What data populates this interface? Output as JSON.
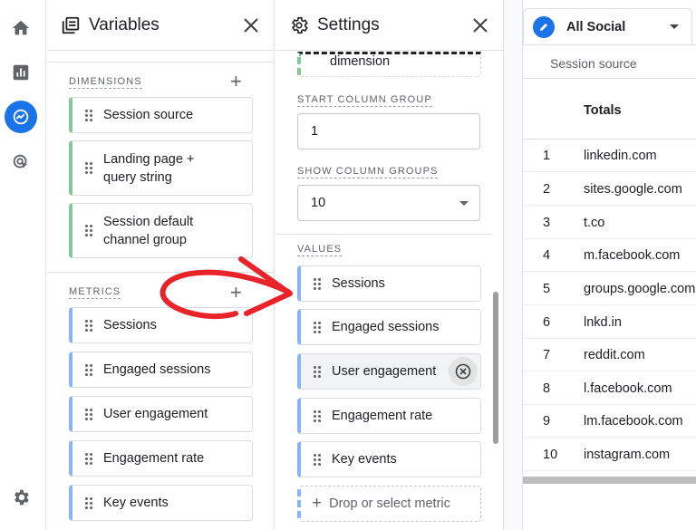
{
  "variables_panel": {
    "title": "Variables",
    "dimensions_label": "DIMENSIONS",
    "dimensions": [
      "Session source",
      "Landing page + query string",
      "Session default channel group"
    ],
    "metrics_label": "METRICS",
    "metrics": [
      "Sessions",
      "Engaged sessions",
      "User engagement",
      "Engagement rate",
      "Key events"
    ]
  },
  "settings_panel": {
    "title": "Settings",
    "partial_item": "dimension",
    "start_column_group_label": "START COLUMN GROUP",
    "start_column_group_value": "1",
    "show_column_groups_label": "SHOW COLUMN GROUPS",
    "show_column_groups_value": "10",
    "values_label": "VALUES",
    "values": [
      "Sessions",
      "Engaged sessions",
      "User engagement",
      "Engagement rate",
      "Key events"
    ],
    "drop_placeholder": "Drop or select metric"
  },
  "table": {
    "segment": "All Social",
    "column_header": "Session source",
    "totals_label": "Totals",
    "rows": [
      {
        "n": "1",
        "source": "linkedin.com"
      },
      {
        "n": "2",
        "source": "sites.google.com"
      },
      {
        "n": "3",
        "source": "t.co"
      },
      {
        "n": "4",
        "source": "m.facebook.com"
      },
      {
        "n": "5",
        "source": "groups.google.com"
      },
      {
        "n": "6",
        "source": "lnkd.in"
      },
      {
        "n": "7",
        "source": "reddit.com"
      },
      {
        "n": "8",
        "source": "l.facebook.com"
      },
      {
        "n": "9",
        "source": "lm.facebook.com"
      },
      {
        "n": "10",
        "source": "instagram.com"
      }
    ]
  },
  "colors": {
    "accent": "#1a73e8",
    "dimension_bar": "#81c995",
    "metric_bar": "#8ab4f8",
    "annotation_arrow": "#e8232a"
  }
}
